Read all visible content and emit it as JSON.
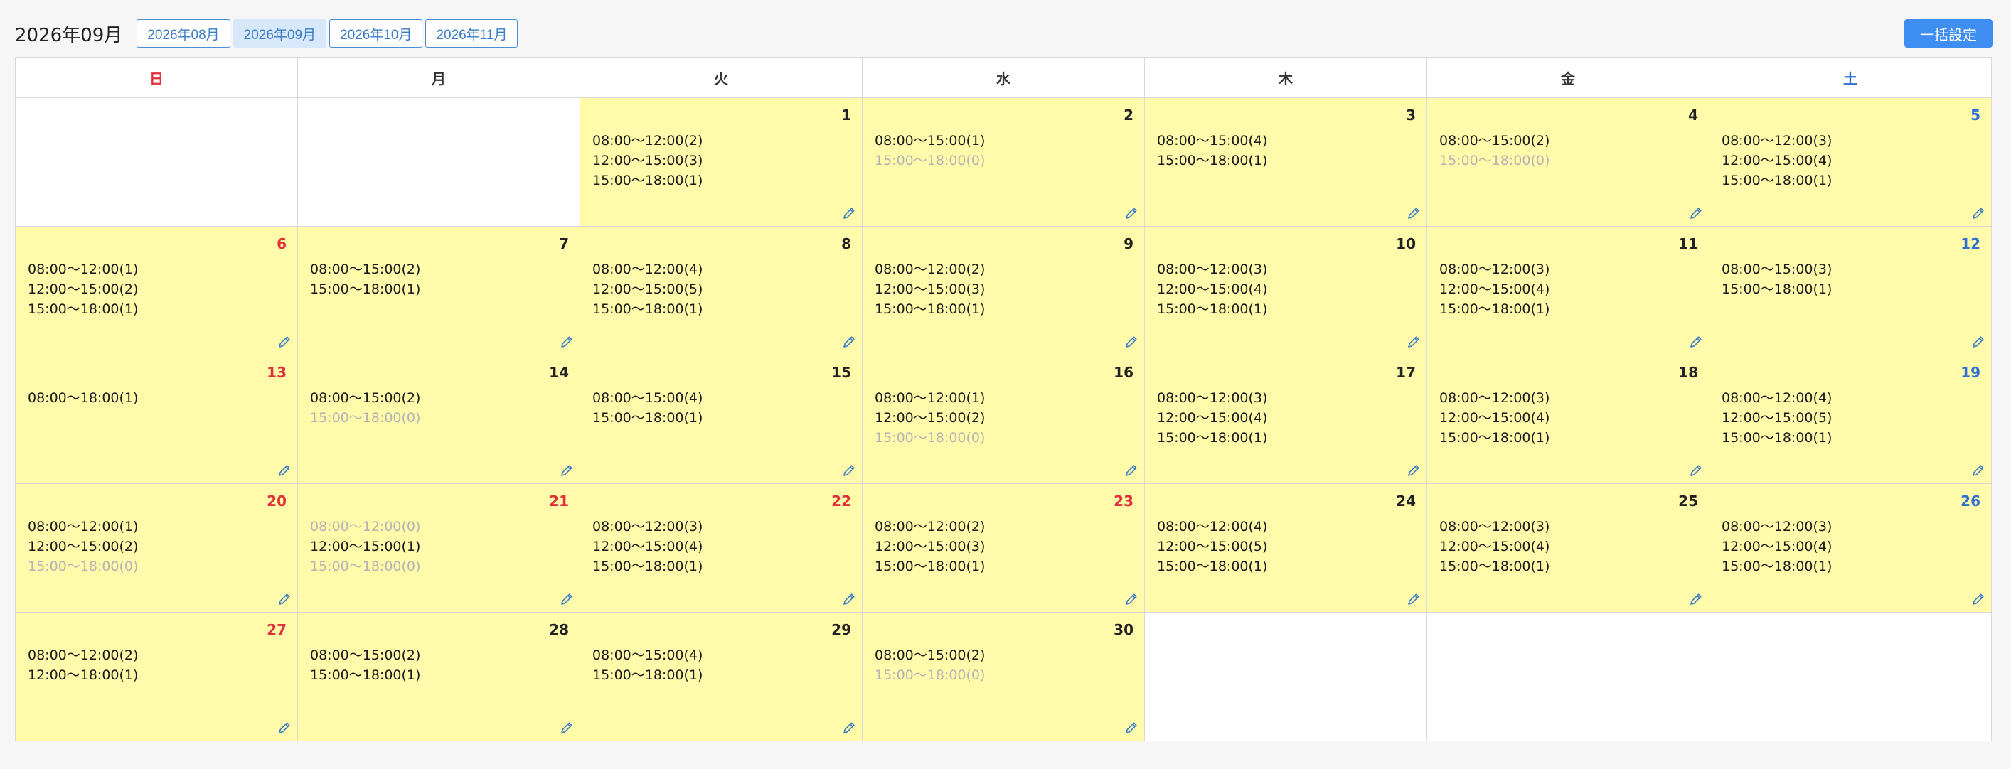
{
  "header": {
    "title": "2026年09月",
    "month_tabs": [
      "2026年08月",
      "2026年09月",
      "2026年10月",
      "2026年11月"
    ],
    "bulk_label": "一括設定"
  },
  "colors": {
    "accent": "#3d8ef0",
    "day_cell_bg": "#fffbaa",
    "holiday_red": "#e0303a",
    "saturday_blue": "#2e6fd1",
    "empty_slot_gray": "#b4b4b4"
  },
  "calendar": {
    "weekdays": [
      "日",
      "月",
      "火",
      "水",
      "木",
      "金",
      "土"
    ],
    "weeks": [
      [
        null,
        null,
        {
          "day": "1",
          "slots": [
            {
              "text": "08:00〜12:00(2)",
              "empty": false
            },
            {
              "text": "12:00〜15:00(3)",
              "empty": false
            },
            {
              "text": "15:00〜18:00(1)",
              "empty": false
            }
          ]
        },
        {
          "day": "2",
          "slots": [
            {
              "text": "08:00〜15:00(1)",
              "empty": false
            },
            {
              "text": "15:00〜18:00(0)",
              "empty": true
            }
          ]
        },
        {
          "day": "3",
          "slots": [
            {
              "text": "08:00〜15:00(4)",
              "empty": false
            },
            {
              "text": "15:00〜18:00(1)",
              "empty": false
            }
          ]
        },
        {
          "day": "4",
          "slots": [
            {
              "text": "08:00〜15:00(2)",
              "empty": false
            },
            {
              "text": "15:00〜18:00(0)",
              "empty": true
            }
          ]
        },
        {
          "day": "5",
          "slots": [
            {
              "text": "08:00〜12:00(3)",
              "empty": false
            },
            {
              "text": "12:00〜15:00(4)",
              "empty": false
            },
            {
              "text": "15:00〜18:00(1)",
              "empty": false
            }
          ]
        }
      ],
      [
        {
          "day": "6",
          "slots": [
            {
              "text": "08:00〜12:00(1)",
              "empty": false
            },
            {
              "text": "12:00〜15:00(2)",
              "empty": false
            },
            {
              "text": "15:00〜18:00(1)",
              "empty": false
            }
          ]
        },
        {
          "day": "7",
          "slots": [
            {
              "text": "08:00〜15:00(2)",
              "empty": false
            },
            {
              "text": "15:00〜18:00(1)",
              "empty": false
            }
          ]
        },
        {
          "day": "8",
          "slots": [
            {
              "text": "08:00〜12:00(4)",
              "empty": false
            },
            {
              "text": "12:00〜15:00(5)",
              "empty": false
            },
            {
              "text": "15:00〜18:00(1)",
              "empty": false
            }
          ]
        },
        {
          "day": "9",
          "slots": [
            {
              "text": "08:00〜12:00(2)",
              "empty": false
            },
            {
              "text": "12:00〜15:00(3)",
              "empty": false
            },
            {
              "text": "15:00〜18:00(1)",
              "empty": false
            }
          ]
        },
        {
          "day": "10",
          "slots": [
            {
              "text": "08:00〜12:00(3)",
              "empty": false
            },
            {
              "text": "12:00〜15:00(4)",
              "empty": false
            },
            {
              "text": "15:00〜18:00(1)",
              "empty": false
            }
          ]
        },
        {
          "day": "11",
          "slots": [
            {
              "text": "08:00〜12:00(3)",
              "empty": false
            },
            {
              "text": "12:00〜15:00(4)",
              "empty": false
            },
            {
              "text": "15:00〜18:00(1)",
              "empty": false
            }
          ]
        },
        {
          "day": "12",
          "slots": [
            {
              "text": "08:00〜15:00(3)",
              "empty": false
            },
            {
              "text": "15:00〜18:00(1)",
              "empty": false
            }
          ]
        }
      ],
      [
        {
          "day": "13",
          "slots": [
            {
              "text": "08:00〜18:00(1)",
              "empty": false
            }
          ]
        },
        {
          "day": "14",
          "slots": [
            {
              "text": "08:00〜15:00(2)",
              "empty": false
            },
            {
              "text": "15:00〜18:00(0)",
              "empty": true
            }
          ]
        },
        {
          "day": "15",
          "slots": [
            {
              "text": "08:00〜15:00(4)",
              "empty": false
            },
            {
              "text": "15:00〜18:00(1)",
              "empty": false
            }
          ]
        },
        {
          "day": "16",
          "slots": [
            {
              "text": "08:00〜12:00(1)",
              "empty": false
            },
            {
              "text": "12:00〜15:00(2)",
              "empty": false
            },
            {
              "text": "15:00〜18:00(0)",
              "empty": true
            }
          ]
        },
        {
          "day": "17",
          "slots": [
            {
              "text": "08:00〜12:00(3)",
              "empty": false
            },
            {
              "text": "12:00〜15:00(4)",
              "empty": false
            },
            {
              "text": "15:00〜18:00(1)",
              "empty": false
            }
          ]
        },
        {
          "day": "18",
          "slots": [
            {
              "text": "08:00〜12:00(3)",
              "empty": false
            },
            {
              "text": "12:00〜15:00(4)",
              "empty": false
            },
            {
              "text": "15:00〜18:00(1)",
              "empty": false
            }
          ]
        },
        {
          "day": "19",
          "slots": [
            {
              "text": "08:00〜12:00(4)",
              "empty": false
            },
            {
              "text": "12:00〜15:00(5)",
              "empty": false
            },
            {
              "text": "15:00〜18:00(1)",
              "empty": false
            }
          ]
        }
      ],
      [
        {
          "day": "20",
          "holiday": true,
          "slots": [
            {
              "text": "08:00〜12:00(1)",
              "empty": false
            },
            {
              "text": "12:00〜15:00(2)",
              "empty": false
            },
            {
              "text": "15:00〜18:00(0)",
              "empty": true
            }
          ]
        },
        {
          "day": "21",
          "holiday": true,
          "slots": [
            {
              "text": "08:00〜12:00(0)",
              "empty": true
            },
            {
              "text": "12:00〜15:00(1)",
              "empty": false
            },
            {
              "text": "15:00〜18:00(0)",
              "empty": true
            }
          ]
        },
        {
          "day": "22",
          "holiday": true,
          "slots": [
            {
              "text": "08:00〜12:00(3)",
              "empty": false
            },
            {
              "text": "12:00〜15:00(4)",
              "empty": false
            },
            {
              "text": "15:00〜18:00(1)",
              "empty": false
            }
          ]
        },
        {
          "day": "23",
          "holiday": true,
          "slots": [
            {
              "text": "08:00〜12:00(2)",
              "empty": false
            },
            {
              "text": "12:00〜15:00(3)",
              "empty": false
            },
            {
              "text": "15:00〜18:00(1)",
              "empty": false
            }
          ]
        },
        {
          "day": "24",
          "slots": [
            {
              "text": "08:00〜12:00(4)",
              "empty": false
            },
            {
              "text": "12:00〜15:00(5)",
              "empty": false
            },
            {
              "text": "15:00〜18:00(1)",
              "empty": false
            }
          ]
        },
        {
          "day": "25",
          "slots": [
            {
              "text": "08:00〜12:00(3)",
              "empty": false
            },
            {
              "text": "12:00〜15:00(4)",
              "empty": false
            },
            {
              "text": "15:00〜18:00(1)",
              "empty": false
            }
          ]
        },
        {
          "day": "26",
          "slots": [
            {
              "text": "08:00〜12:00(3)",
              "empty": false
            },
            {
              "text": "12:00〜15:00(4)",
              "empty": false
            },
            {
              "text": "15:00〜18:00(1)",
              "empty": false
            }
          ]
        }
      ],
      [
        {
          "day": "27",
          "slots": [
            {
              "text": "08:00〜12:00(2)",
              "empty": false
            },
            {
              "text": "12:00〜18:00(1)",
              "empty": false
            }
          ]
        },
        {
          "day": "28",
          "slots": [
            {
              "text": "08:00〜15:00(2)",
              "empty": false
            },
            {
              "text": "15:00〜18:00(1)",
              "empty": false
            }
          ]
        },
        {
          "day": "29",
          "slots": [
            {
              "text": "08:00〜15:00(4)",
              "empty": false
            },
            {
              "text": "15:00〜18:00(1)",
              "empty": false
            }
          ]
        },
        {
          "day": "30",
          "slots": [
            {
              "text": "08:00〜15:00(2)",
              "empty": false
            },
            {
              "text": "15:00〜18:00(0)",
              "empty": true
            }
          ]
        },
        null,
        null,
        null
      ]
    ]
  }
}
